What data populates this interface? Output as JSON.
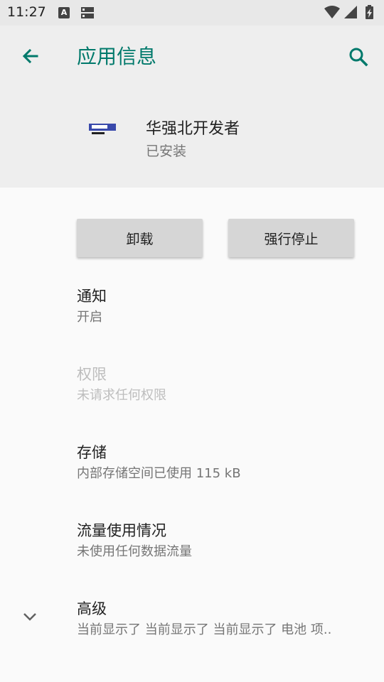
{
  "status_bar": {
    "time": "11:27",
    "notification_icons": [
      "font-a-icon",
      "sd-card-icon"
    ],
    "system_icons": [
      "wifi-icon",
      "cell-signal-icon",
      "battery-charging-icon"
    ]
  },
  "header": {
    "title": "应用信息",
    "back_icon": "arrow-back-icon",
    "search_icon": "search-icon",
    "accent_color": "#00796b"
  },
  "app": {
    "name": "华强北开发者",
    "status": "已安装"
  },
  "actions": {
    "uninstall_label": "卸载",
    "force_stop_label": "强行停止"
  },
  "settings": [
    {
      "title": "通知",
      "subtitle": "开启"
    },
    {
      "title": "权限",
      "subtitle": "未请求任何权限"
    },
    {
      "title": "存储",
      "subtitle": "内部存储空间已使用 115 kB"
    },
    {
      "title": "流量使用情况",
      "subtitle": "未使用任何数据流量"
    },
    {
      "title": "高级",
      "subtitle": "当前显示了 当前显示了 当前显示了 电池 项.."
    }
  ]
}
